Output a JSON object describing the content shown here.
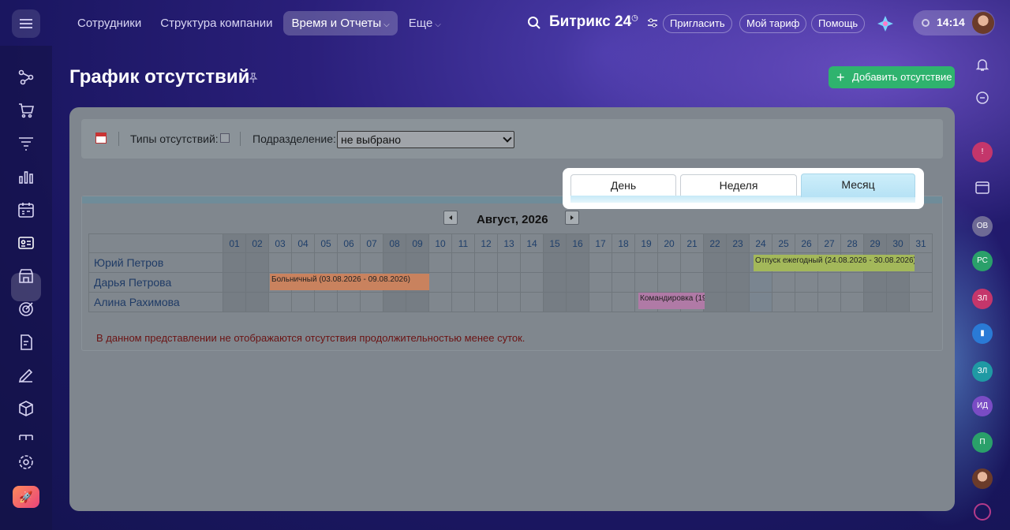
{
  "topbar": {
    "nav": [
      {
        "label": "Сотрудники"
      },
      {
        "label": "Структура компании"
      },
      {
        "label": "Время и Отчеты"
      },
      {
        "label": "Еще"
      }
    ],
    "brand": "Битрикс 24",
    "invite": "Пригласить",
    "tariff": "Мой тариф",
    "help": "Помощь",
    "time": "14:14"
  },
  "page": {
    "title": "График отсутствий",
    "add_button": "Добавить отсутствие"
  },
  "filters": {
    "types_label": "Типы отсутствий:",
    "dept_label": "Подразделение:",
    "dept_value": "не выбрано"
  },
  "tabs": [
    "День",
    "Неделя",
    "Месяц"
  ],
  "calendar": {
    "month": "Август, 2026",
    "days": [
      "01",
      "02",
      "03",
      "04",
      "05",
      "06",
      "07",
      "08",
      "09",
      "10",
      "11",
      "12",
      "13",
      "14",
      "15",
      "16",
      "17",
      "18",
      "19",
      "20",
      "21",
      "22",
      "23",
      "24",
      "25",
      "26",
      "27",
      "28",
      "29",
      "30",
      "31"
    ],
    "employees": [
      "Юрий Петров",
      "Дарья Петрова",
      "Алина Рахимова"
    ],
    "absences": [
      {
        "text": "Отпуск ежегодный (24.08.2026 - 30.08.2026)",
        "color": "#a3b85a"
      },
      {
        "text": "Больничный (03.08.2026 - 09.08.2026)",
        "color": "#c9825e"
      },
      {
        "text": "Командировка (19",
        "color": "#b07aa6"
      }
    ],
    "note": "В данном представлении не отображаются отсутствия продолжительностью менее суток."
  },
  "rail": [
    "ОВ",
    "РС",
    "ЗЛ",
    "ЗЛ",
    "ИД",
    "П"
  ]
}
